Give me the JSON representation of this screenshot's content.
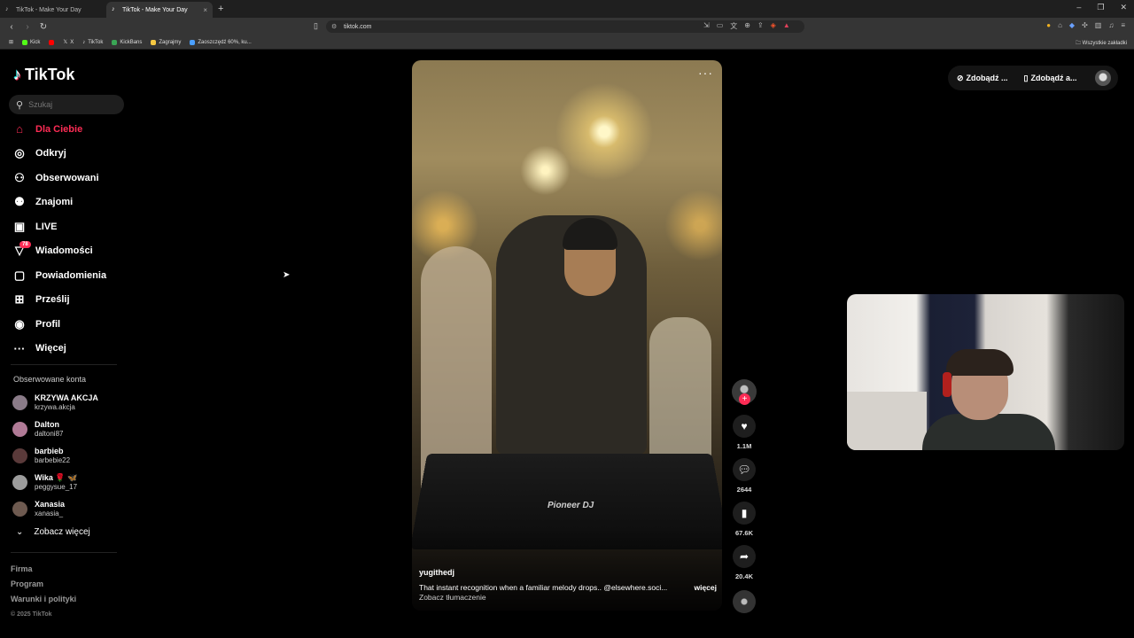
{
  "browser": {
    "tabs": [
      {
        "title": "TikTok - Make Your Day",
        "active": false
      },
      {
        "title": "TikTok - Make Your Day",
        "active": true
      }
    ],
    "url": "tiktok.com",
    "bookmarks": [
      "Kick",
      "X",
      "TikTok",
      "KickBans",
      "Zagrajmy",
      "Zaoszczędź 60%, ku..."
    ],
    "bookmarks_all": "Wszystkie zakładki"
  },
  "tiktok": {
    "logo": "TikTok",
    "search_placeholder": "Szukaj",
    "nav": [
      {
        "label": "Dla Ciebie",
        "icon": "home-icon",
        "active": true
      },
      {
        "label": "Odkryj",
        "icon": "compass-icon"
      },
      {
        "label": "Obserwowani",
        "icon": "following-icon"
      },
      {
        "label": "Znajomi",
        "icon": "friends-icon"
      },
      {
        "label": "LIVE",
        "icon": "live-icon"
      },
      {
        "label": "Wiadomości",
        "icon": "messages-icon",
        "badge": "78"
      },
      {
        "label": "Powiadomienia",
        "icon": "notifications-icon"
      },
      {
        "label": "Prześlij",
        "icon": "upload-icon"
      },
      {
        "label": "Profil",
        "icon": "profile-icon"
      },
      {
        "label": "Więcej",
        "icon": "more-icon"
      }
    ],
    "following_title": "Obserwowane konta",
    "accounts": [
      {
        "name": "KRZYWA AKCJA",
        "handle": "krzywa.akcja"
      },
      {
        "name": "Dalton",
        "handle": "daltoni87"
      },
      {
        "name": "barbieb",
        "handle": "barbebie22"
      },
      {
        "name": "Wika 🌹 🦋",
        "handle": "peggysue_17"
      },
      {
        "name": "Xanasia",
        "handle": "xanasia_"
      }
    ],
    "see_more": "Zobacz więcej",
    "footer": [
      "Firma",
      "Program",
      "Warunki i polityki"
    ],
    "copyright": "© 2025 TikTok",
    "top_buttons": [
      "Zdobądź ...",
      "Zdobądź a..."
    ],
    "video": {
      "author": "yugithedj",
      "description": "That instant recognition when a familiar melody drops.. @elsewhere.soci...",
      "more": "więcej",
      "translate": "Zobacz tłumaczenie",
      "deck_brand": "Pioneer DJ"
    },
    "actions": {
      "likes": "1.1M",
      "comments": "2644",
      "saves": "67.6K",
      "shares": "20.4K"
    }
  },
  "colors": {
    "accent": "#fe2c55",
    "background": "#000000"
  }
}
